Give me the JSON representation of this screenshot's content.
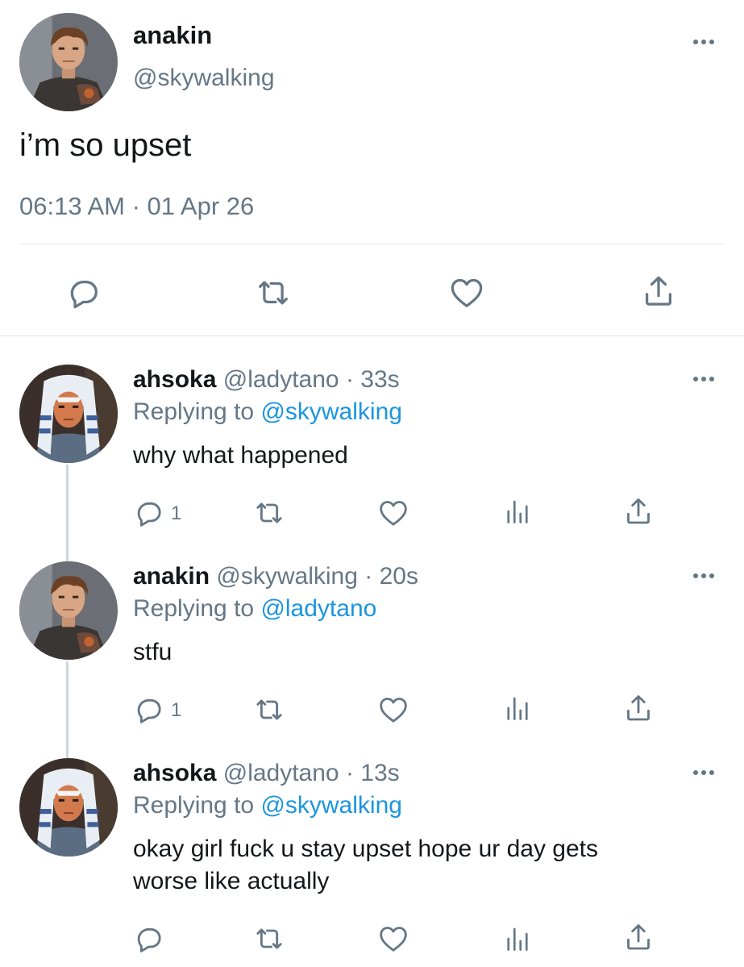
{
  "main_tweet": {
    "display_name": "anakin",
    "handle": "@skywalking",
    "text": "i’m so upset",
    "timestamp": "06:13 AM · 01 Apr 26",
    "actions": [
      "reply-icon",
      "retweet-icon",
      "like-icon",
      "share-icon"
    ]
  },
  "replies": [
    {
      "display_name": "ahsoka",
      "handle": "@ladytano",
      "time": "· 33s",
      "replying_label": "Replying to",
      "replying_to": "@skywalking",
      "text": "why what happened",
      "reply_count": "1"
    },
    {
      "display_name": "anakin",
      "handle": "@skywalking",
      "time": "· 20s",
      "replying_label": "Replying to",
      "replying_to": "@ladytano",
      "text": "stfu",
      "reply_count": "1"
    },
    {
      "display_name": "ahsoka",
      "handle": "@ladytano",
      "time": "· 13s",
      "replying_label": "Replying to",
      "replying_to": "@skywalking",
      "text_line1": "okay girl fuck u stay upset hope ur day gets",
      "text_line2": "worse like actually",
      "reply_count": ""
    }
  ],
  "colors": {
    "text": "#14171a",
    "secondary": "#657786",
    "link": "#1b95e0",
    "divider": "#e1e8ed"
  }
}
